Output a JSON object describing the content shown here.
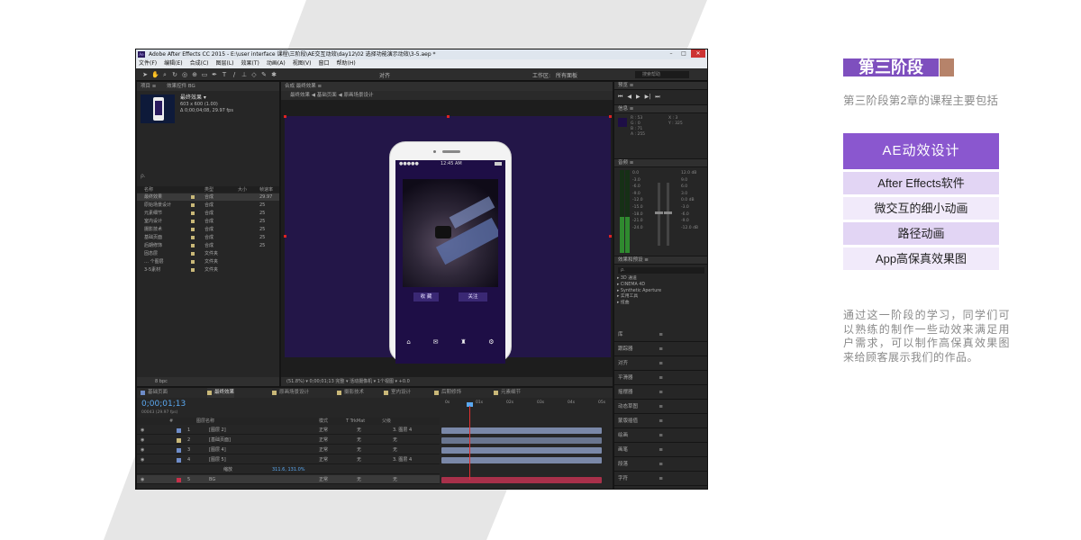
{
  "colors": {
    "accent_purple": "#8a57cf",
    "title_bar_purple": "#7e4fbe",
    "swatch_brown": "#b6836a",
    "item_light": "#e2d5f4",
    "item_lighter": "#f1eafa",
    "desc_grey": "#8a8a8a",
    "composition_bg": "#231648"
  },
  "stage": {
    "title": "第三阶段",
    "subtitle": "第三阶段第2章的课程主要包括"
  },
  "course": {
    "heading": "AE动效设计",
    "items": [
      "After Effects软件",
      "微交互的细小动画",
      "路径动画",
      "App高保真效果图"
    ]
  },
  "summary": "通过这一阶段的学习，同学们可以熟练的制作一些动效来满足用户需求，可以制作高保真效果图来给顾客展示我们的作品。",
  "ae": {
    "window_title": "Adobe After Effects CC 2015 - E:\\user interface 课程\\三阶段\\AE交互动效\\day12\\02 选择功能演示动效\\3-5.aep *",
    "menu": [
      "文件(F)",
      "编辑(E)",
      "合成(C)",
      "图层(L)",
      "效果(T)",
      "动画(A)",
      "视图(V)",
      "窗口",
      "帮助(H)"
    ],
    "toolbar": {
      "align": "对齐",
      "workspace": "工作区:",
      "workspace_value": "所有面板",
      "search_placeholder": "搜索帮助"
    },
    "project": {
      "tab": "项目 ≡",
      "effect_tab": "效果控件 BG",
      "comp_name": "最终效果 ▾",
      "comp_size": "603 x 600 (1.00)",
      "comp_duration": "Δ 0;00;04;08, 29.97 fps",
      "search": "ρ.",
      "columns": [
        "名称",
        "类型",
        "大小",
        "帧速率"
      ],
      "rows": [
        {
          "name": "最终效果",
          "type": "合成",
          "fps": "29.97",
          "color": "#c9b878"
        },
        {
          "name": "原始场景设计",
          "type": "合成",
          "fps": "25",
          "color": "#c9b878"
        },
        {
          "name": "元素细节",
          "type": "合成",
          "fps": "25",
          "color": "#c9b878"
        },
        {
          "name": "室内设计",
          "type": "合成",
          "fps": "25",
          "color": "#c9b878"
        },
        {
          "name": "摄影技术",
          "type": "合成",
          "fps": "25",
          "color": "#c9b878"
        },
        {
          "name": "基础页面",
          "type": "合成",
          "fps": "25",
          "color": "#c9b878"
        },
        {
          "name": "后期修饰",
          "type": "合成",
          "fps": "25",
          "color": "#c9b878"
        },
        {
          "name": "固态层",
          "type": "文件夹",
          "fps": "",
          "color": "#c9b878"
        },
        {
          "name": "… 个图层",
          "type": "文件夹",
          "fps": "",
          "color": "#c9b878"
        },
        {
          "name": "3-5素材",
          "type": "文件夹",
          "fps": "",
          "color": "#c9b878"
        }
      ],
      "bottom": "8 bpc"
    },
    "composition": {
      "tab": "合成 最终效果 ≡",
      "breadcrumb": "最终效果  ◀ 基础页面  ◀ 原画场景设计",
      "status_left": "●●●●●",
      "status_time": "12:45 AM",
      "fav_left": "收  藏",
      "fav_right": "关注",
      "bottom": "(51.8%) ▾   0;00;01;13   完整   ▾   活动摄像机 ▾   1个视图 ▾   +0.0"
    },
    "preview": {
      "title": "预览 ≡",
      "controls": [
        "⏮",
        "◀",
        "▶",
        "▶|",
        "⏭"
      ]
    },
    "info": {
      "title": "信息 ≡",
      "rgba": "R : 53\nG : 0\nB : 71\nA : 255",
      "xy": "X : 3\nY : 325"
    },
    "audio": {
      "title": "音频 ≡",
      "left_scale": [
        "0.0",
        "-3.0",
        "-6.0",
        "-9.0",
        "-12.0",
        "-15.0",
        "-18.0",
        "-21.0",
        "-24.0"
      ],
      "right_scale": [
        "12.0 dB",
        "9.0",
        "6.0",
        "3.0",
        "0.0 dB",
        "-3.0",
        "-6.0",
        "-9.0",
        "-12.0 dB"
      ]
    },
    "effects_presets": {
      "title": "效果和预设 ≡",
      "items": [
        "▸ 3D 通道",
        "▸ CINEMA 4D",
        "▸ Synthetic Aperture",
        "▸ 实用工具",
        "▸ 扭曲"
      ]
    },
    "right_items": [
      "库",
      "跟踪器",
      "对齐",
      "平滑器",
      "摇摆器",
      "动态草图",
      "蒙版插值",
      "绘画",
      "画笔",
      "段落",
      "字符"
    ],
    "timeline": {
      "tabs": [
        {
          "label": "基础页面",
          "color": "#6e8cc8"
        },
        {
          "label": "最终效果",
          "color": "#c9b878"
        },
        {
          "label": "原画场景设计",
          "color": "#c9b878"
        },
        {
          "label": "摄影技术",
          "color": "#c9b878"
        },
        {
          "label": "室内设计",
          "color": "#c9b878"
        },
        {
          "label": "后期修饰",
          "color": "#c9b878"
        },
        {
          "label": "元素细节",
          "color": "#c9b878"
        }
      ],
      "timecode": "0;00;01;13",
      "timecode_sub": "00043 (29.97 fps)",
      "columns": [
        "#",
        "图层名称",
        "模式",
        "T TrkMat",
        "父级"
      ],
      "ruler": [
        "0s",
        "01s",
        "02s",
        "03s",
        "04s",
        "05s"
      ],
      "layers": [
        {
          "num": "1",
          "name": "[图层 2]",
          "mode": "正常",
          "trk": "无",
          "parent": "3. 图层 4",
          "color": "#6e8cc8",
          "track_color": "#7a88a8"
        },
        {
          "num": "2",
          "name": "[基础页面]",
          "mode": "正常",
          "trk": "无",
          "parent": "无",
          "color": "#c9b878",
          "track_color": "#6a7690"
        },
        {
          "num": "3",
          "name": "[图层 4]",
          "mode": "正常",
          "trk": "无",
          "parent": "无",
          "color": "#6e8cc8",
          "track_color": "#7a88a8"
        },
        {
          "num": "4",
          "name": "[图层 5]",
          "mode": "正常",
          "trk": "无",
          "parent": "3. 图层 4",
          "color": "#6e8cc8",
          "track_color": "#7a88a8"
        },
        {
          "num": "",
          "name": "缩放",
          "mode": "",
          "trk": "",
          "parent": "",
          "value": "311.6, 131.0%",
          "color": "",
          "track_color": ""
        },
        {
          "num": "5",
          "name": "BG",
          "mode": "正常",
          "trk": "无",
          "parent": "无",
          "color": "#c8304a",
          "track_color": "#a8304a"
        }
      ]
    }
  }
}
